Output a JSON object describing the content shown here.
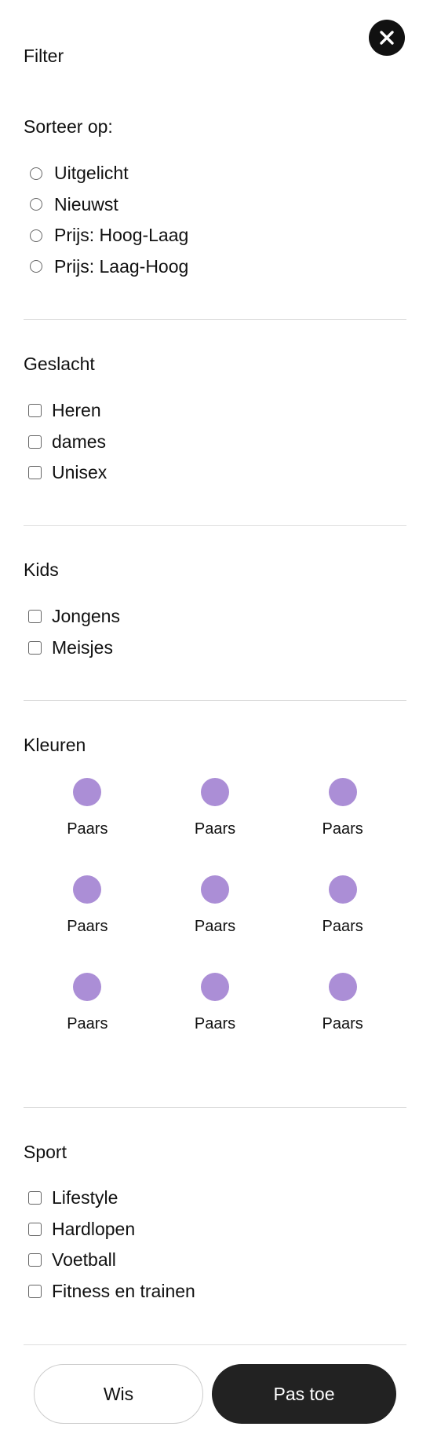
{
  "header": {
    "title": "Filter",
    "close_icon": "close-icon"
  },
  "sort": {
    "title": "Sorteer op:",
    "options": [
      {
        "label": "Uitgelicht"
      },
      {
        "label": "Nieuwst"
      },
      {
        "label": "Prijs: Hoog-Laag"
      },
      {
        "label": "Prijs: Laag-Hoog"
      }
    ]
  },
  "gender": {
    "title": "Geslacht",
    "options": [
      {
        "label": "Heren"
      },
      {
        "label": "dames"
      },
      {
        "label": "Unisex"
      }
    ]
  },
  "kids": {
    "title": "Kids",
    "options": [
      {
        "label": "Jongens"
      },
      {
        "label": "Meisjes"
      }
    ]
  },
  "colors": {
    "title": "Kleuren",
    "items": [
      {
        "label": "Paars",
        "color": "#ab8ed6"
      },
      {
        "label": "Paars",
        "color": "#ab8ed6"
      },
      {
        "label": "Paars",
        "color": "#ab8ed6"
      },
      {
        "label": "Paars",
        "color": "#ab8ed6"
      },
      {
        "label": "Paars",
        "color": "#ab8ed6"
      },
      {
        "label": "Paars",
        "color": "#ab8ed6"
      },
      {
        "label": "Paars",
        "color": "#ab8ed6"
      },
      {
        "label": "Paars",
        "color": "#ab8ed6"
      },
      {
        "label": "Paars",
        "color": "#ab8ed6"
      }
    ]
  },
  "sport": {
    "title": "Sport",
    "options": [
      {
        "label": "Lifestyle"
      },
      {
        "label": "Hardlopen"
      },
      {
        "label": "Voetball"
      },
      {
        "label": "Fitness en trainen"
      }
    ]
  },
  "footer": {
    "clear_label": "Wis",
    "apply_label": "Pas toe"
  }
}
